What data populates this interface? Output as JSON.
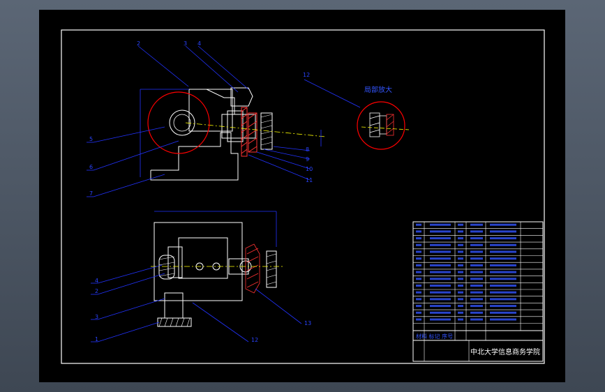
{
  "colors": {
    "background": "#4a5461",
    "sheet": "#000000",
    "frame": "#ffffff",
    "part_outline": "#ffffff",
    "leader_line": "#2233ff",
    "detail_circle": "#ff0000",
    "hatch": "#ff2222",
    "center_line": "#ffff00",
    "table_text": "#3355ff"
  },
  "drawing": {
    "detail_view_label": "局部放大",
    "top_view_callouts": [
      "2",
      "3",
      "4",
      "5",
      "6",
      "7",
      "8",
      "9",
      "10",
      "11",
      "12"
    ],
    "bottom_view_callouts": [
      "1",
      "2",
      "3",
      "4",
      "12",
      "13"
    ]
  },
  "title_block": {
    "table_title": "材料 标记 序号",
    "school": "中北大学信息商务学院"
  }
}
